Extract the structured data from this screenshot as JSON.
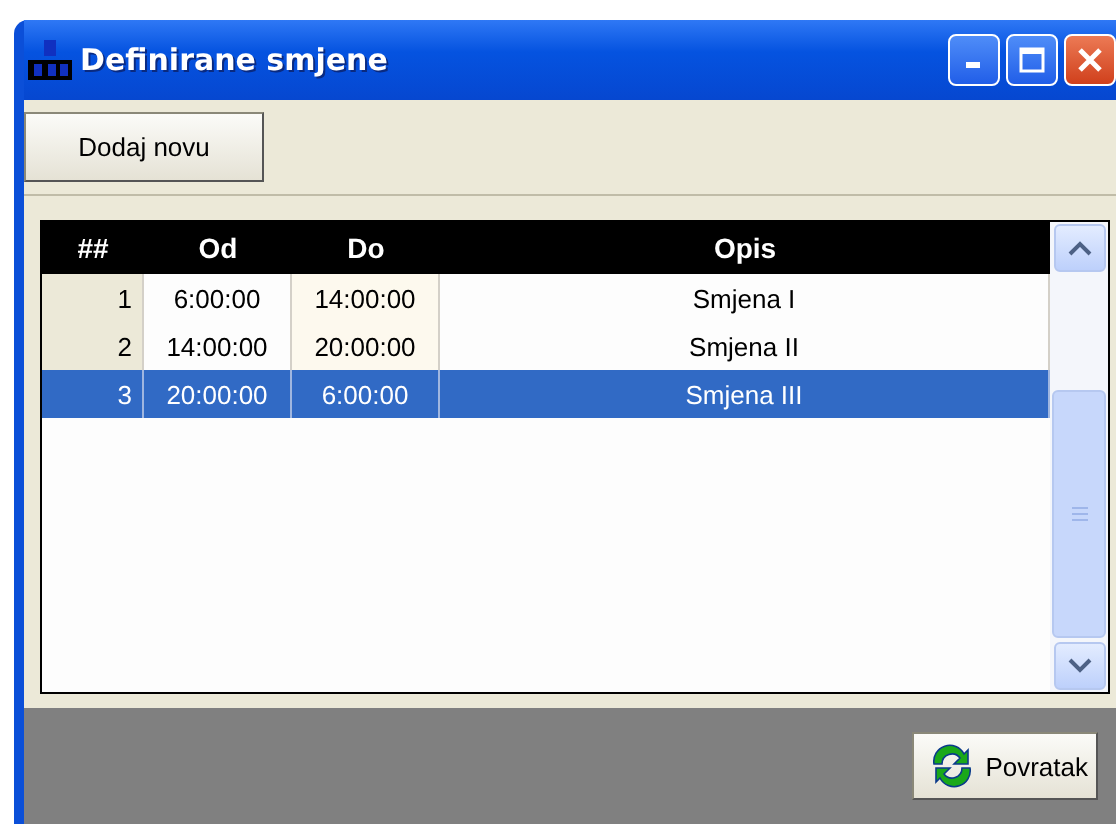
{
  "window": {
    "title": "Definirane smjene"
  },
  "toolbar": {
    "add_button": "Dodaj novu"
  },
  "table": {
    "columns": [
      "##",
      "Od",
      "Do",
      "Opis"
    ],
    "rows": [
      {
        "cells": [
          "1",
          "6:00:00",
          "14:00:00",
          "Smjena I"
        ],
        "selected": false
      },
      {
        "cells": [
          "2",
          "14:00:00",
          "20:00:00",
          "Smjena II"
        ],
        "selected": false
      },
      {
        "cells": [
          "3",
          "20:00:00",
          "6:00:00",
          "Smjena III"
        ],
        "selected": true
      }
    ]
  },
  "footer": {
    "back_button": "Povratak"
  }
}
